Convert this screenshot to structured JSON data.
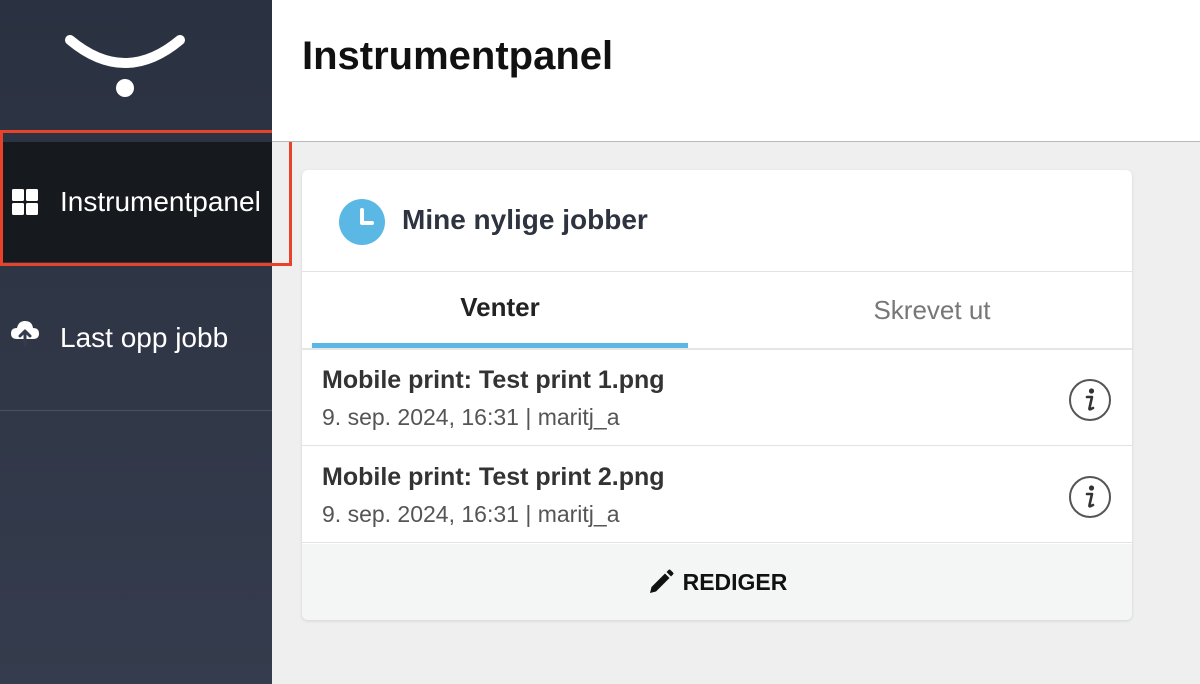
{
  "header": {
    "title": "Instrumentpanel"
  },
  "sidebar": {
    "items": [
      {
        "label": "Instrumentpanel",
        "icon": "dashboard-icon",
        "active": true
      },
      {
        "label": "Last opp jobb",
        "icon": "cloud-upload-icon",
        "active": false
      }
    ]
  },
  "card": {
    "title": "Mine nylige jobber",
    "icon": "clock-icon",
    "tabs": [
      {
        "label": "Venter",
        "active": true
      },
      {
        "label": "Skrevet ut",
        "active": false
      }
    ],
    "jobs": [
      {
        "title": "Mobile print: Test print 1.png",
        "meta": "9. sep. 2024, 16:31 | maritj_a"
      },
      {
        "title": "Mobile print: Test print 2.png",
        "meta": "9. sep. 2024, 16:31 | maritj_a"
      }
    ],
    "edit_label": "REDIGER"
  },
  "colors": {
    "sidebar": "#2a3140",
    "active_nav": "#16191e",
    "accent": "#5bb8e4",
    "highlight": "#e8432a"
  }
}
